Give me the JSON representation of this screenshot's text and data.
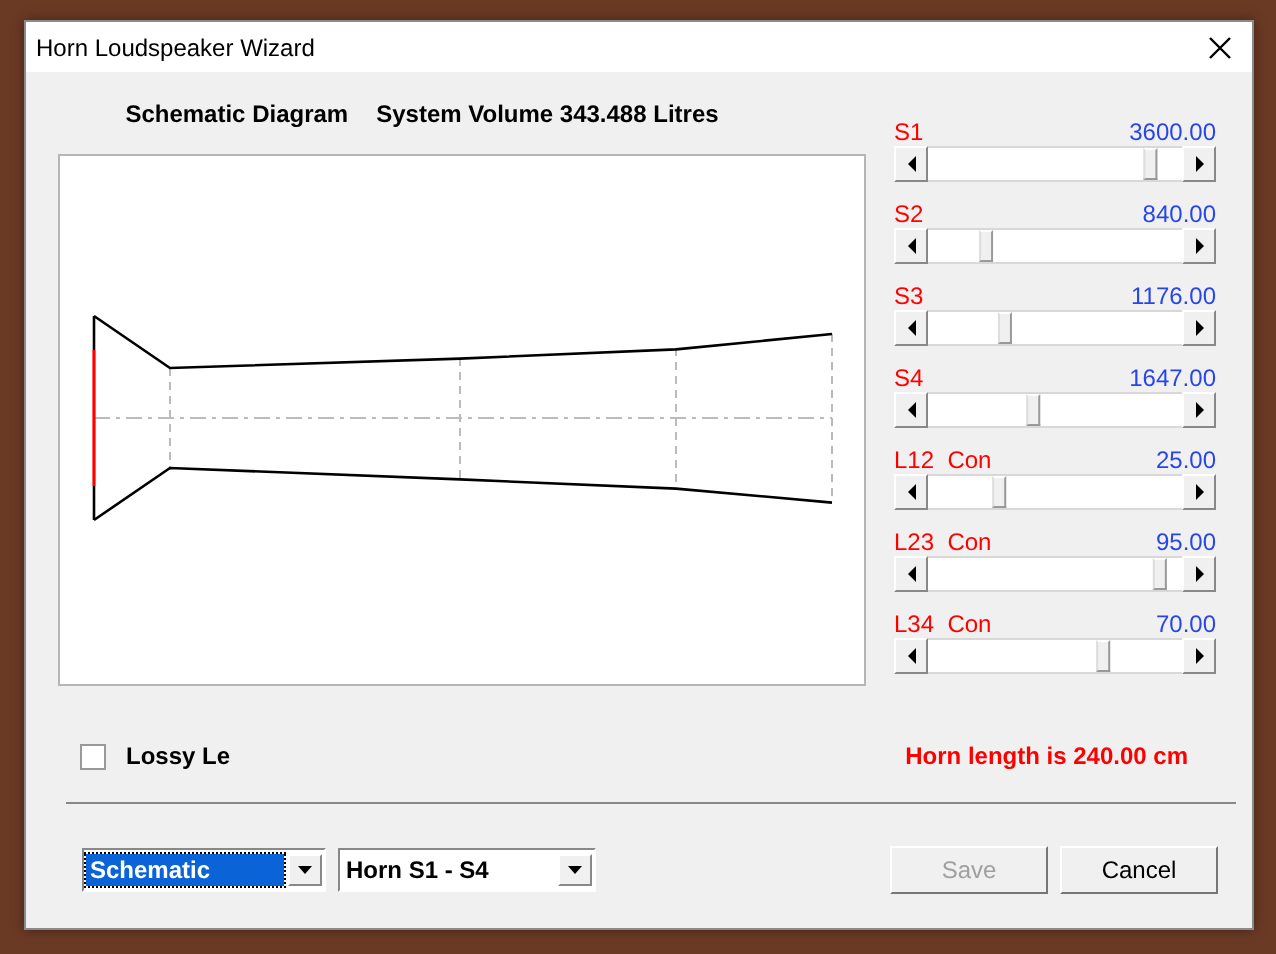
{
  "window": {
    "title": "Horn Loudspeaker Wizard"
  },
  "header": {
    "title": "Schematic Diagram",
    "volume": "System Volume 343.488 Litres"
  },
  "sliders": [
    {
      "label": "S1",
      "value": "3600.00",
      "level": 0.9
    },
    {
      "label": "S2",
      "value": "840.00",
      "level": 0.21
    },
    {
      "label": "S3",
      "value": "1176.00",
      "level": 0.29
    },
    {
      "label": "S4",
      "value": "1647.00",
      "level": 0.41
    },
    {
      "label": "L12",
      "sub": "Con",
      "value": "25.00",
      "level": 0.27
    },
    {
      "label": "L23",
      "sub": "Con",
      "value": "95.00",
      "level": 0.94
    },
    {
      "label": "L34",
      "sub": "Con",
      "value": "70.00",
      "level": 0.7
    }
  ],
  "lossy": {
    "label": "Lossy Le",
    "checked": false
  },
  "horn_length": "Horn length is 240.00 cm",
  "dropdowns": [
    {
      "value": "Schematic",
      "focused": true
    },
    {
      "value": "Horn S1 - S4",
      "focused": false
    }
  ],
  "buttons": [
    {
      "label": "Save",
      "disabled": true
    },
    {
      "label": "Cancel",
      "disabled": false
    }
  ]
}
